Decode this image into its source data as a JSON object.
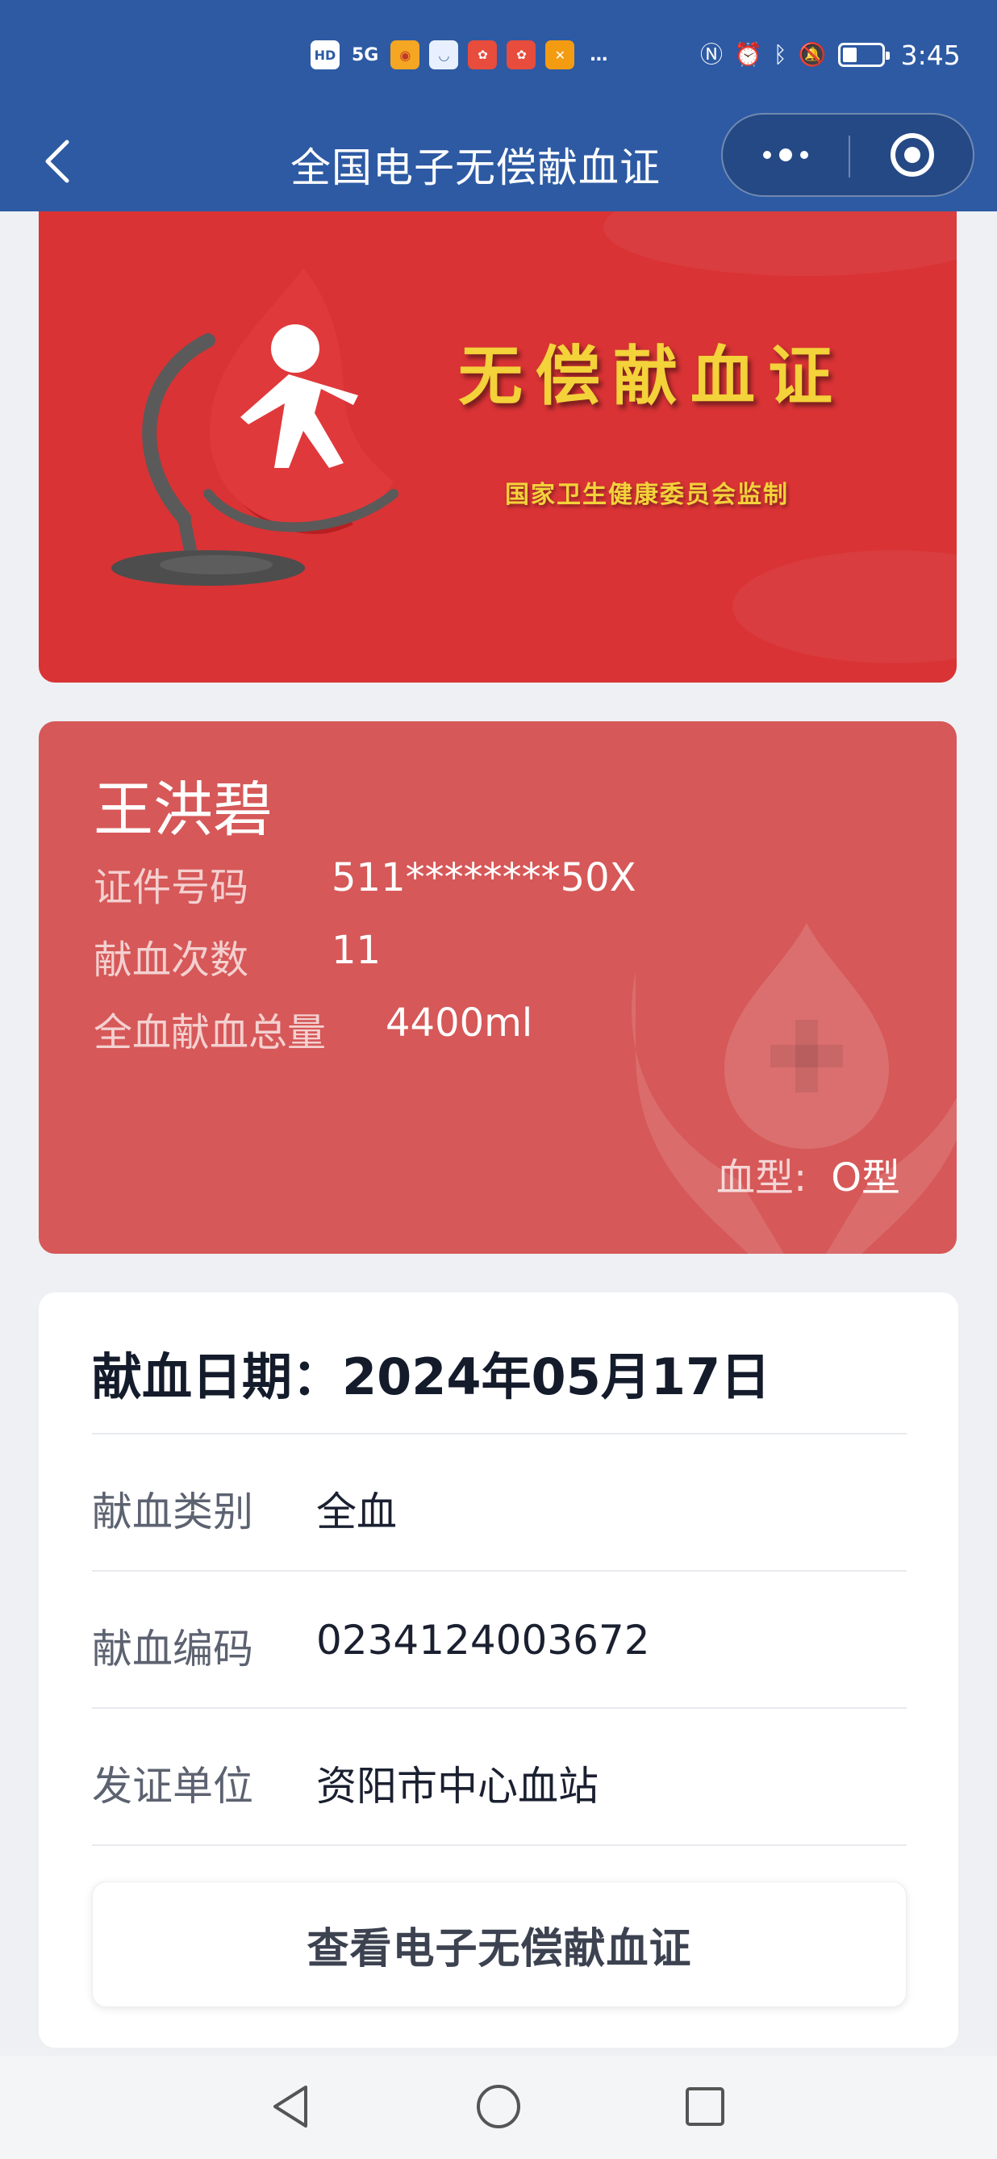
{
  "status_bar": {
    "time": "3:45",
    "left_icons": [
      "HD",
      "5G",
      "weibo-app-icon",
      "chat-app-icon",
      "red-app-icon",
      "red-app-icon",
      "orange-app-icon",
      "…"
    ],
    "right_icons": [
      "nfc-icon",
      "alarm-icon",
      "bluetooth-icon",
      "mute-icon",
      "battery-icon"
    ],
    "battery_level": 0.38
  },
  "nav": {
    "title": "全国电子无偿献血证"
  },
  "banner": {
    "title": "无偿献血证",
    "subtitle": "国家卫生健康委员会监制"
  },
  "holder": {
    "name": "王洪碧",
    "id_label": "证件号码",
    "id_value": "511********50X",
    "count_label": "献血次数",
    "count_value": "11",
    "total_label": "全血献血总量",
    "total_value": "4400ml",
    "blood_type_label": "血型:",
    "blood_type_value": "O型"
  },
  "detail": {
    "date_text": "献血日期：2024年05月17日",
    "rows": [
      {
        "label": "献血类别",
        "value": "全血"
      },
      {
        "label": "献血编码",
        "value": "0234124003672"
      },
      {
        "label": "发证单位",
        "value": "资阳市中心血站"
      }
    ],
    "button_label": "查看电子无偿献血证"
  },
  "colors": {
    "nav_blue": "#2d5aa3",
    "banner_red": "#d93335",
    "card_red": "#d65858",
    "title_gold": "#f3d23a"
  }
}
